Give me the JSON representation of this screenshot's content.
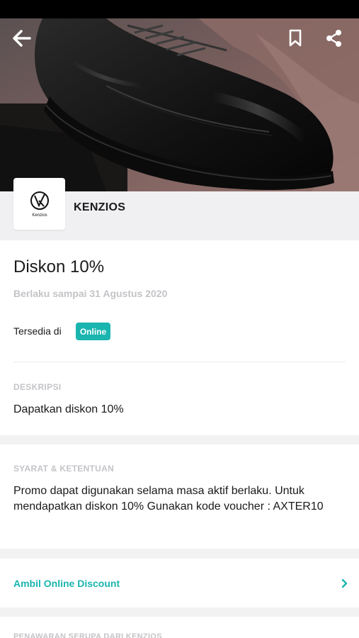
{
  "merchant": {
    "name": "KENZIOS",
    "logo_text": "Kenzios"
  },
  "offer": {
    "title": "Diskon 10%",
    "valid_until": "Berlaku sampai 31 Agustus 2020",
    "available_label": "Tersedia di",
    "available_channel": "Online"
  },
  "description": {
    "label": "DESKRIPSI",
    "text": "Dapatkan diskon 10%"
  },
  "terms": {
    "label": "SYARAT & KETENTUAN",
    "text": "Promo dapat digunakan selama masa aktif berlaku. Untuk mendapatkan diskon 10% Gunakan kode voucher : AXTER10"
  },
  "action": {
    "label": "Ambil Online Discount"
  },
  "bottom_section": {
    "label": "PENAWARAN SERUPA DARI KENZIOS"
  },
  "icons": {
    "back": "arrow-left-icon",
    "bookmark": "bookmark-icon",
    "share": "share-icon",
    "chevron": "chevron-right-icon"
  },
  "colors": {
    "accent": "#1bb5b0",
    "muted": "#c4c4c8",
    "text": "#1a1a1a"
  }
}
